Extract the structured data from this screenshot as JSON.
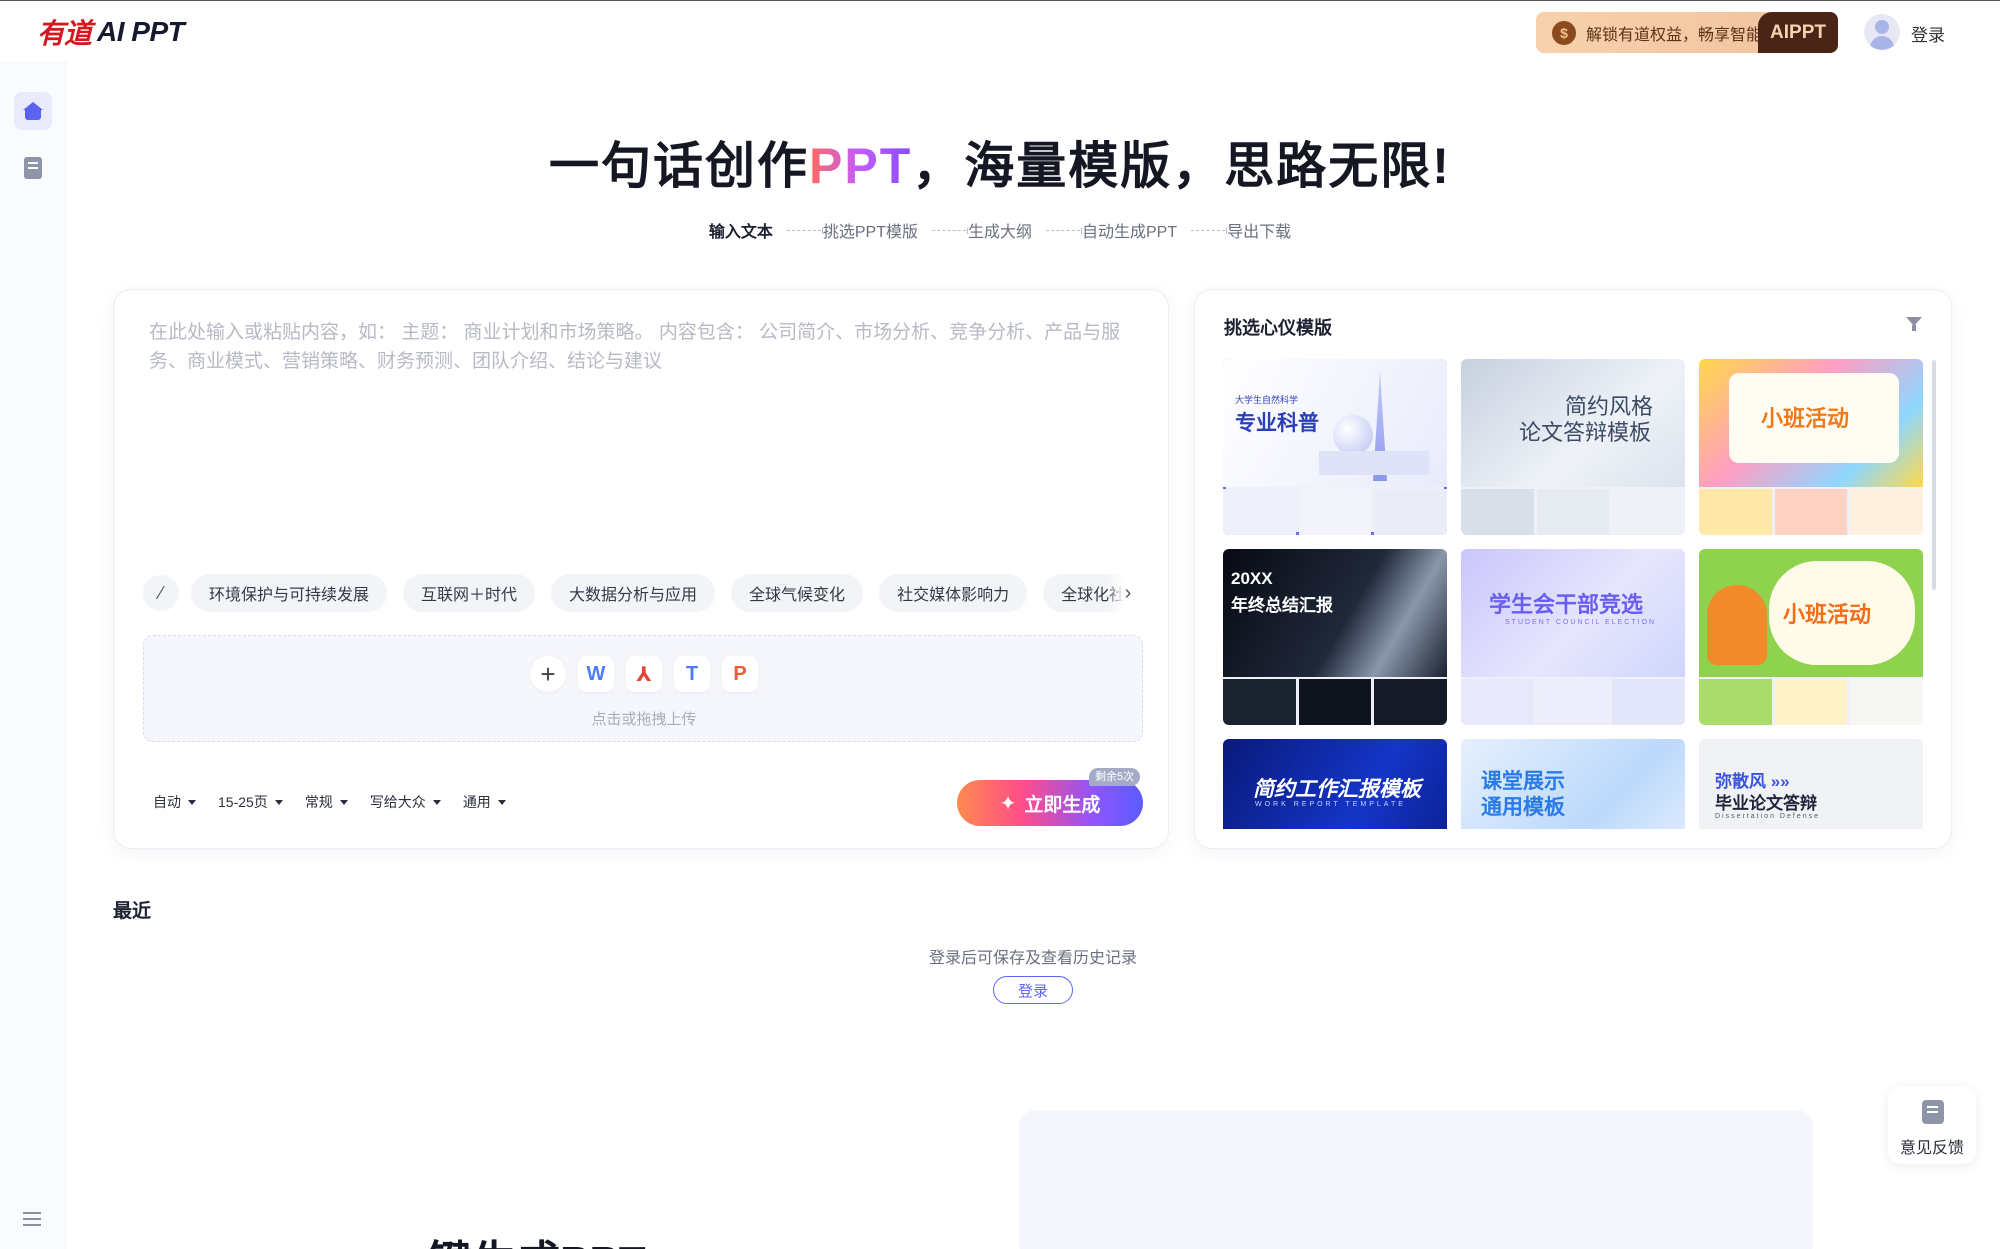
{
  "header": {
    "logo_cn": "有道",
    "logo_en": "AI PPT",
    "vip_text": "解锁有道权益，畅享智能",
    "vip_tag": "AIPPT",
    "login": "登录"
  },
  "hero": {
    "title_before": "一句话创作",
    "title_highlight": "PPT",
    "title_after": "，海量模版，思路无限!"
  },
  "steps": [
    "输入文本",
    "挑选PPT模版",
    "生成大纲",
    "自动生成PPT",
    "导出下载"
  ],
  "input": {
    "placeholder": "在此处输入或粘贴内容，如： 主题： 商业计划和市场策略。 内容包含： 公司简介、市场分析、竞争分析、产品与服务、商业模式、营销策略、财务预测、团队介绍、结论与建议",
    "topics": [
      "环境保护与可持续发展",
      "互联网＋时代",
      "大数据分析与应用",
      "全球气候变化",
      "社交媒体影响力",
      "全球化社"
    ],
    "upload_hint": "点击或拖拽上传",
    "upload_icons": {
      "plus": "+",
      "word": "W",
      "pdf": "⅄",
      "txt": "T",
      "pptx": "P"
    },
    "options": [
      "自动",
      "15-25页",
      "常规",
      "写给大众",
      "通用"
    ],
    "generate_label": "立即生成",
    "remaining": "剩余5次"
  },
  "templates": {
    "title": "挑选心仪模版",
    "items": [
      {
        "name": "专业科普",
        "sub": "大学生自然科学",
        "selected": true,
        "bg": "#f1f3fc",
        "color": "#2c3fb8"
      },
      {
        "name": "简约风格论文答辩模板",
        "line1": "简约风格",
        "line2": "论文答辩模板",
        "bg": "#dfe5ef",
        "color": "#3c4a63"
      },
      {
        "name": "小班活动",
        "bg": "#fff4d6",
        "color": "#f07a1a"
      },
      {
        "name": "20XX年终总结汇报",
        "line1": "20XX",
        "line2": "年终总结汇报",
        "bg": "#0f1420",
        "color": "#ffffff"
      },
      {
        "name": "学生会干部竞选",
        "sub": "STUDENT COUNCIL ELECTION",
        "bg": "#dcdcfa",
        "color": "#6a5ef0"
      },
      {
        "name": "小班活动",
        "bg": "#8fd24e",
        "color": "#f06d1a"
      },
      {
        "name": "简约工作汇报模板",
        "sub": "WORK REPORT TEMPLATE",
        "bg": "#0e1f8f",
        "color": "#ffffff"
      },
      {
        "name": "课堂展示通用模板",
        "line1": "课堂展示",
        "line2": "通用模板",
        "bg": "#d9e9fb",
        "color": "#2a7be6"
      },
      {
        "name": "弥散风毕业论文答辩",
        "line1": "弥散风 »»",
        "line2": "毕业论文答辩",
        "sub": "Dissertation Defense",
        "bg": "#f1f2f6",
        "color": "#22253a"
      }
    ]
  },
  "recent": {
    "title": "最近",
    "hint": "登录后可保存及查看历史记录",
    "login": "登录"
  },
  "bottom": {
    "heading": "一键生成PPT"
  },
  "feedback": {
    "label": "意见反馈"
  },
  "colors": {
    "accent": "#5f64f3",
    "brand_red": "#d4181e"
  }
}
